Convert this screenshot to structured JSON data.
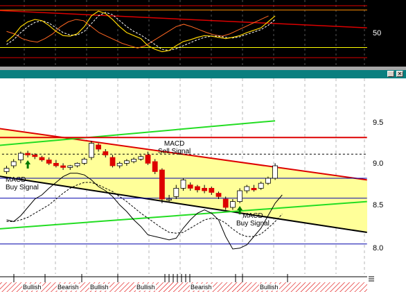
{
  "window": {
    "minimize_label": "_",
    "close_label": "✕"
  },
  "oscillator": {
    "y_labels": [
      "50"
    ]
  },
  "price": {
    "y_labels": [
      "9.5",
      "9.0",
      "8.5",
      "8.0"
    ]
  },
  "annotations": [
    {
      "text": "MACD\nSell Signal"
    },
    {
      "text": "MACD\nBuy Signal"
    },
    {
      "text": "MACD\nBuy Signal"
    }
  ],
  "signal_strip": {
    "segments": [
      {
        "label": "Bullish"
      },
      {
        "label": "Bearish"
      },
      {
        "label": "Bullish"
      },
      {
        "label": "Bullish"
      },
      {
        "label": "Bearish"
      },
      {
        "label": "Bullish"
      }
    ]
  },
  "colors": {
    "up": "#ffffff",
    "down": "#dd0000",
    "channel_fill": "#ffff99",
    "red_line": "#dd0000",
    "green_line": "#22dd22",
    "black_line": "#000000",
    "blue_line": "#0000aa",
    "signal_arrow_up": "#007700",
    "signal_arrow_down": "#dd0000",
    "hatch": "#dd0000",
    "teal": "#0a7f7f"
  },
  "chart_data": {
    "type": "candlestick",
    "title": "",
    "ylim": [
      7.8,
      9.9
    ],
    "y_ticks": [
      9.5,
      9.0,
      8.5,
      8.0
    ],
    "candles": [
      {
        "o": 8.88,
        "h": 8.95,
        "c": 8.92,
        "l": 8.85
      },
      {
        "o": 8.95,
        "h": 9.03,
        "c": 9.0,
        "l": 8.92
      },
      {
        "o": 9.02,
        "h": 9.12,
        "c": 9.1,
        "l": 8.98
      },
      {
        "o": 9.1,
        "h": 9.13,
        "c": 9.08,
        "l": 9.05
      },
      {
        "o": 9.08,
        "h": 9.1,
        "c": 9.06,
        "l": 9.03
      },
      {
        "o": 9.05,
        "h": 9.07,
        "c": 9.02,
        "l": 9.0
      },
      {
        "o": 9.02,
        "h": 9.05,
        "c": 8.98,
        "l": 8.96
      },
      {
        "o": 8.98,
        "h": 9.02,
        "c": 8.95,
        "l": 8.93
      },
      {
        "o": 8.95,
        "h": 8.98,
        "c": 8.93,
        "l": 8.9
      },
      {
        "o": 8.93,
        "h": 8.96,
        "c": 8.95,
        "l": 8.9
      },
      {
        "o": 8.95,
        "h": 8.99,
        "c": 8.98,
        "l": 8.93
      },
      {
        "o": 8.98,
        "h": 9.05,
        "c": 9.03,
        "l": 8.96
      },
      {
        "o": 9.05,
        "h": 9.25,
        "c": 9.22,
        "l": 9.02
      },
      {
        "o": 9.2,
        "h": 9.22,
        "c": 9.15,
        "l": 9.12
      },
      {
        "o": 9.12,
        "h": 9.15,
        "c": 9.08,
        "l": 9.05
      },
      {
        "o": 9.05,
        "h": 9.08,
        "c": 8.95,
        "l": 8.93
      },
      {
        "o": 8.95,
        "h": 9.0,
        "c": 8.98,
        "l": 8.92
      },
      {
        "o": 8.98,
        "h": 9.03,
        "c": 9.01,
        "l": 8.95
      },
      {
        "o": 9.0,
        "h": 9.05,
        "c": 9.03,
        "l": 8.98
      },
      {
        "o": 9.03,
        "h": 9.08,
        "c": 9.06,
        "l": 9.01
      },
      {
        "o": 9.08,
        "h": 9.12,
        "c": 8.98,
        "l": 8.96
      },
      {
        "o": 9.0,
        "h": 9.03,
        "c": 8.88,
        "l": 8.85
      },
      {
        "o": 8.9,
        "h": 8.92,
        "c": 8.55,
        "l": 8.5
      },
      {
        "o": 8.55,
        "h": 8.6,
        "c": 8.55,
        "l": 8.52
      },
      {
        "o": 8.58,
        "h": 8.72,
        "c": 8.68,
        "l": 8.55
      },
      {
        "o": 8.68,
        "h": 8.8,
        "c": 8.78,
        "l": 8.65
      },
      {
        "o": 8.72,
        "h": 8.75,
        "c": 8.68,
        "l": 8.65
      },
      {
        "o": 8.7,
        "h": 8.72,
        "c": 8.66,
        "l": 8.63
      },
      {
        "o": 8.68,
        "h": 8.72,
        "c": 8.65,
        "l": 8.62
      },
      {
        "o": 8.68,
        "h": 8.7,
        "c": 8.63,
        "l": 8.6
      },
      {
        "o": 8.62,
        "h": 8.64,
        "c": 8.58,
        "l": 8.55
      },
      {
        "o": 8.55,
        "h": 8.58,
        "c": 8.45,
        "l": 8.42
      },
      {
        "o": 8.45,
        "h": 8.55,
        "c": 8.52,
        "l": 8.42
      },
      {
        "o": 8.52,
        "h": 8.68,
        "c": 8.65,
        "l": 8.5
      },
      {
        "o": 8.65,
        "h": 8.72,
        "c": 8.7,
        "l": 8.62
      },
      {
        "o": 8.68,
        "h": 8.72,
        "c": 8.66,
        "l": 8.64
      },
      {
        "o": 8.68,
        "h": 8.76,
        "c": 8.74,
        "l": 8.66
      },
      {
        "o": 8.74,
        "h": 8.82,
        "c": 8.8,
        "l": 8.72
      },
      {
        "o": 8.8,
        "h": 8.98,
        "c": 8.95,
        "l": 8.78
      }
    ],
    "signals": [
      {
        "candle": 3,
        "dir": "buy"
      },
      {
        "candle": 21,
        "dir": "sell"
      },
      {
        "candle": 33,
        "dir": "buy"
      }
    ],
    "lines": [
      {
        "kind": "red",
        "points": [
          [
            -3,
            9.42
          ],
          [
            51,
            8.78
          ]
        ]
      },
      {
        "kind": "black",
        "points": [
          [
            -3,
            8.85
          ],
          [
            51,
            8.15
          ]
        ]
      },
      {
        "kind": "green",
        "points": [
          [
            -3,
            9.18
          ],
          [
            38,
            9.49
          ]
        ]
      },
      {
        "kind": "green",
        "points": [
          [
            -3,
            8.18
          ],
          [
            51,
            8.52
          ]
        ]
      },
      {
        "kind": "red",
        "points": [
          [
            -3,
            9.29
          ],
          [
            51,
            9.29
          ]
        ]
      },
      {
        "kind": "blue",
        "points": [
          [
            -3,
            8.8
          ],
          [
            51,
            8.8
          ]
        ]
      },
      {
        "kind": "blue",
        "points": [
          [
            -3,
            8.56
          ],
          [
            51,
            8.56
          ]
        ]
      },
      {
        "kind": "blue",
        "points": [
          [
            -3,
            8.01
          ],
          [
            51,
            8.01
          ]
        ]
      },
      {
        "kind": "dashed",
        "points": [
          [
            -3,
            9.09
          ],
          [
            51,
            9.09
          ]
        ]
      }
    ],
    "macd": [
      8.3,
      8.28,
      8.35,
      8.45,
      8.55,
      8.6,
      8.68,
      8.75,
      8.82,
      8.86,
      8.86,
      8.84,
      8.78,
      8.7,
      8.65,
      8.58,
      8.48,
      8.4,
      8.3,
      8.22,
      8.12,
      8.1,
      8.08,
      8.06,
      8.08,
      8.2,
      8.3,
      8.38,
      8.42,
      8.38,
      8.3,
      8.1,
      7.95,
      7.96,
      8.0,
      8.1,
      8.2,
      8.35,
      8.5,
      8.6
    ],
    "macd_signal": [
      8.28,
      8.28,
      8.3,
      8.33,
      8.38,
      8.43,
      8.48,
      8.55,
      8.62,
      8.68,
      8.72,
      8.75,
      8.75,
      8.72,
      8.68,
      8.64,
      8.58,
      8.52,
      8.45,
      8.38,
      8.32,
      8.26,
      8.2,
      8.15,
      8.14,
      8.15,
      8.2,
      8.25,
      8.3,
      8.32,
      8.31,
      8.26,
      8.19,
      8.13,
      8.1,
      8.1,
      8.13,
      8.2,
      8.28,
      8.37
    ],
    "stoch_k": [
      35,
      45,
      60,
      68,
      72,
      70,
      62,
      52,
      45,
      44,
      48,
      60,
      78,
      86,
      82,
      72,
      60,
      50,
      45,
      40,
      28,
      22,
      18,
      20,
      28,
      35,
      38,
      42,
      45,
      44,
      42,
      40,
      42,
      45,
      50,
      54,
      58,
      68,
      78
    ],
    "stoch_d": [
      30,
      38,
      50,
      60,
      67,
      70,
      66,
      58,
      50,
      46,
      46,
      52,
      65,
      78,
      84,
      80,
      70,
      60,
      52,
      46,
      38,
      30,
      22,
      20,
      23,
      28,
      33,
      38,
      42,
      44,
      44,
      42,
      41,
      43,
      47,
      51,
      55,
      62,
      72
    ],
    "rsi": [
      52,
      48,
      40,
      36,
      34,
      40,
      48,
      60,
      68,
      72,
      70,
      60,
      50,
      44,
      38,
      32,
      28,
      24,
      28,
      36,
      44,
      52,
      60,
      64,
      60,
      55,
      50,
      46,
      44,
      48,
      54,
      60,
      66,
      72,
      78
    ],
    "osc_ylim": [
      0,
      100
    ],
    "osc_ticks": [
      50
    ],
    "osc_levels": [
      {
        "value": 95,
        "color": "#dd0000"
      },
      {
        "value": 88,
        "color": "#ff8c00"
      },
      {
        "value": 25,
        "color": "#ffff00"
      },
      {
        "value": 8,
        "color": "#dd0000"
      }
    ],
    "osc_trend": {
      "points": [
        [
          -3,
          88
        ],
        [
          51,
          58
        ]
      ]
    }
  }
}
